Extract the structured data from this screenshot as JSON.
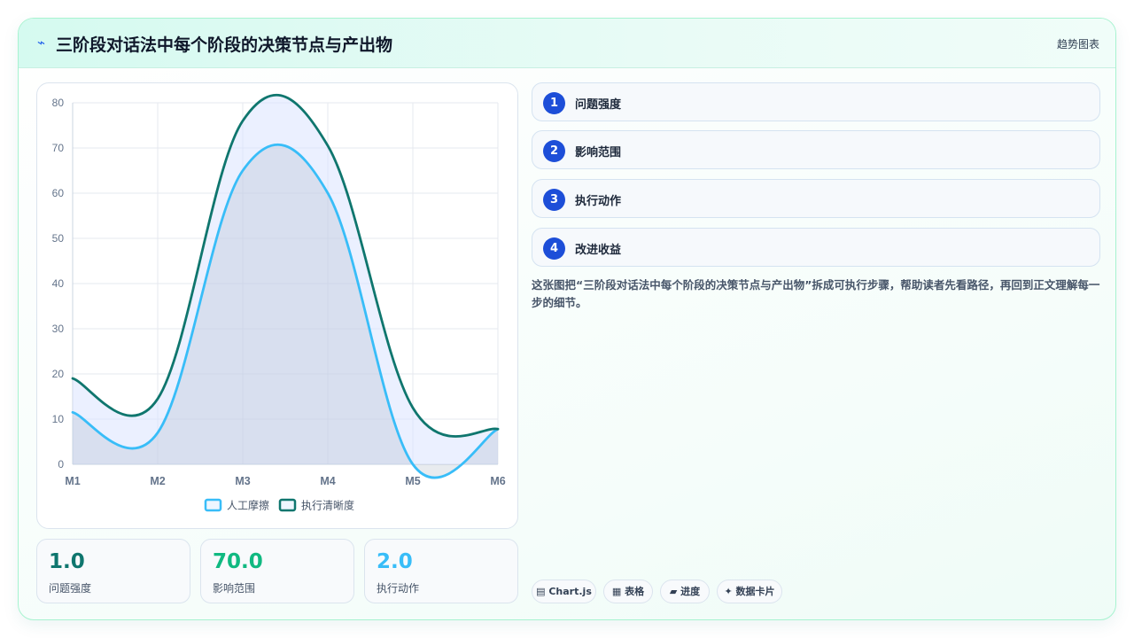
{
  "header": {
    "icon": "bolt-icon",
    "title": "三阶段对话法中每个阶段的决策节点与产出物",
    "tag": "趋势图表"
  },
  "chart_data": {
    "type": "area",
    "x": [
      "M1",
      "M2",
      "M3",
      "M4",
      "M5",
      "M6"
    ],
    "ylim": [
      0,
      80
    ],
    "yticks": [
      0,
      10,
      20,
      30,
      40,
      50,
      60,
      70,
      80
    ],
    "grid": true,
    "legend_position": "bottom",
    "series": [
      {
        "name": "人工摩擦",
        "values": [
          11.5,
          7,
          65,
          60,
          0,
          7.8
        ],
        "color": "#38bdf8"
      },
      {
        "name": "执行清晰度",
        "values": [
          19,
          14.5,
          76,
          70.5,
          12.5,
          7.8
        ],
        "color": "#0f766e"
      }
    ]
  },
  "stats": [
    {
      "value": "1.0",
      "label": "问题强度",
      "color": "#0f766e"
    },
    {
      "value": "70.0",
      "label": "影响范围",
      "color": "#10b981"
    },
    {
      "value": "2.0",
      "label": "执行动作",
      "color": "#38bdf8"
    }
  ],
  "steps": [
    {
      "num": "1",
      "label": "问题强度"
    },
    {
      "num": "2",
      "label": "影响范围"
    },
    {
      "num": "3",
      "label": "执行动作"
    },
    {
      "num": "4",
      "label": "改进收益"
    }
  ],
  "description": "这张图把“三阶段对话法中每个阶段的决策节点与产出物”拆成可执行步骤，帮助读者先看路径，再回到正文理解每一步的细节。",
  "chips": [
    {
      "icon": "chart-icon",
      "glyph": "▤",
      "label": "Chart.js"
    },
    {
      "icon": "table-icon",
      "glyph": "▦",
      "label": "表格"
    },
    {
      "icon": "progress-icon",
      "glyph": "▰",
      "label": "进度"
    },
    {
      "icon": "sparkle-icon",
      "glyph": "✦",
      "label": "数据卡片"
    }
  ]
}
